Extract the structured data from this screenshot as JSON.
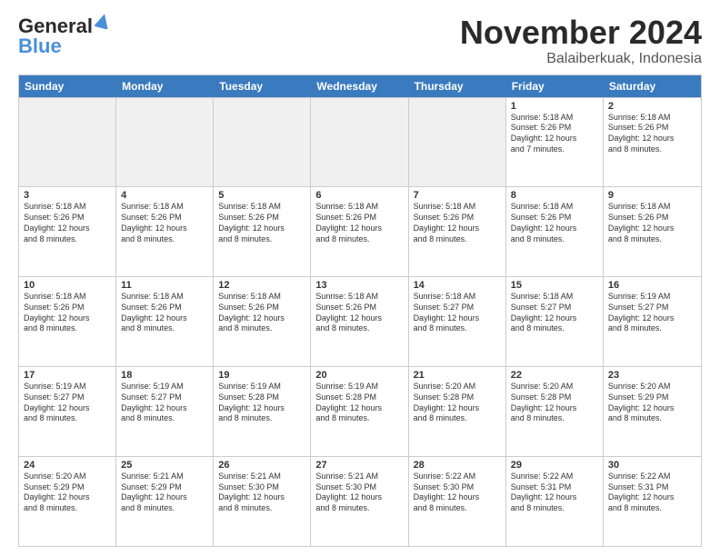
{
  "header": {
    "logo_line1": "General",
    "logo_line2": "Blue",
    "month_title": "November 2024",
    "location": "Balaiberkuak, Indonesia"
  },
  "calendar": {
    "days_of_week": [
      "Sunday",
      "Monday",
      "Tuesday",
      "Wednesday",
      "Thursday",
      "Friday",
      "Saturday"
    ],
    "weeks": [
      [
        {
          "day": "",
          "info": "",
          "empty": true
        },
        {
          "day": "",
          "info": "",
          "empty": true
        },
        {
          "day": "",
          "info": "",
          "empty": true
        },
        {
          "day": "",
          "info": "",
          "empty": true
        },
        {
          "day": "",
          "info": "",
          "empty": true
        },
        {
          "day": "1",
          "info": "Sunrise: 5:18 AM\nSunset: 5:26 PM\nDaylight: 12 hours\nand 7 minutes.",
          "empty": false
        },
        {
          "day": "2",
          "info": "Sunrise: 5:18 AM\nSunset: 5:26 PM\nDaylight: 12 hours\nand 8 minutes.",
          "empty": false
        }
      ],
      [
        {
          "day": "3",
          "info": "Sunrise: 5:18 AM\nSunset: 5:26 PM\nDaylight: 12 hours\nand 8 minutes.",
          "empty": false
        },
        {
          "day": "4",
          "info": "Sunrise: 5:18 AM\nSunset: 5:26 PM\nDaylight: 12 hours\nand 8 minutes.",
          "empty": false
        },
        {
          "day": "5",
          "info": "Sunrise: 5:18 AM\nSunset: 5:26 PM\nDaylight: 12 hours\nand 8 minutes.",
          "empty": false
        },
        {
          "day": "6",
          "info": "Sunrise: 5:18 AM\nSunset: 5:26 PM\nDaylight: 12 hours\nand 8 minutes.",
          "empty": false
        },
        {
          "day": "7",
          "info": "Sunrise: 5:18 AM\nSunset: 5:26 PM\nDaylight: 12 hours\nand 8 minutes.",
          "empty": false
        },
        {
          "day": "8",
          "info": "Sunrise: 5:18 AM\nSunset: 5:26 PM\nDaylight: 12 hours\nand 8 minutes.",
          "empty": false
        },
        {
          "day": "9",
          "info": "Sunrise: 5:18 AM\nSunset: 5:26 PM\nDaylight: 12 hours\nand 8 minutes.",
          "empty": false
        }
      ],
      [
        {
          "day": "10",
          "info": "Sunrise: 5:18 AM\nSunset: 5:26 PM\nDaylight: 12 hours\nand 8 minutes.",
          "empty": false
        },
        {
          "day": "11",
          "info": "Sunrise: 5:18 AM\nSunset: 5:26 PM\nDaylight: 12 hours\nand 8 minutes.",
          "empty": false
        },
        {
          "day": "12",
          "info": "Sunrise: 5:18 AM\nSunset: 5:26 PM\nDaylight: 12 hours\nand 8 minutes.",
          "empty": false
        },
        {
          "day": "13",
          "info": "Sunrise: 5:18 AM\nSunset: 5:26 PM\nDaylight: 12 hours\nand 8 minutes.",
          "empty": false
        },
        {
          "day": "14",
          "info": "Sunrise: 5:18 AM\nSunset: 5:27 PM\nDaylight: 12 hours\nand 8 minutes.",
          "empty": false
        },
        {
          "day": "15",
          "info": "Sunrise: 5:18 AM\nSunset: 5:27 PM\nDaylight: 12 hours\nand 8 minutes.",
          "empty": false
        },
        {
          "day": "16",
          "info": "Sunrise: 5:19 AM\nSunset: 5:27 PM\nDaylight: 12 hours\nand 8 minutes.",
          "empty": false
        }
      ],
      [
        {
          "day": "17",
          "info": "Sunrise: 5:19 AM\nSunset: 5:27 PM\nDaylight: 12 hours\nand 8 minutes.",
          "empty": false
        },
        {
          "day": "18",
          "info": "Sunrise: 5:19 AM\nSunset: 5:27 PM\nDaylight: 12 hours\nand 8 minutes.",
          "empty": false
        },
        {
          "day": "19",
          "info": "Sunrise: 5:19 AM\nSunset: 5:28 PM\nDaylight: 12 hours\nand 8 minutes.",
          "empty": false
        },
        {
          "day": "20",
          "info": "Sunrise: 5:19 AM\nSunset: 5:28 PM\nDaylight: 12 hours\nand 8 minutes.",
          "empty": false
        },
        {
          "day": "21",
          "info": "Sunrise: 5:20 AM\nSunset: 5:28 PM\nDaylight: 12 hours\nand 8 minutes.",
          "empty": false
        },
        {
          "day": "22",
          "info": "Sunrise: 5:20 AM\nSunset: 5:28 PM\nDaylight: 12 hours\nand 8 minutes.",
          "empty": false
        },
        {
          "day": "23",
          "info": "Sunrise: 5:20 AM\nSunset: 5:29 PM\nDaylight: 12 hours\nand 8 minutes.",
          "empty": false
        }
      ],
      [
        {
          "day": "24",
          "info": "Sunrise: 5:20 AM\nSunset: 5:29 PM\nDaylight: 12 hours\nand 8 minutes.",
          "empty": false
        },
        {
          "day": "25",
          "info": "Sunrise: 5:21 AM\nSunset: 5:29 PM\nDaylight: 12 hours\nand 8 minutes.",
          "empty": false
        },
        {
          "day": "26",
          "info": "Sunrise: 5:21 AM\nSunset: 5:30 PM\nDaylight: 12 hours\nand 8 minutes.",
          "empty": false
        },
        {
          "day": "27",
          "info": "Sunrise: 5:21 AM\nSunset: 5:30 PM\nDaylight: 12 hours\nand 8 minutes.",
          "empty": false
        },
        {
          "day": "28",
          "info": "Sunrise: 5:22 AM\nSunset: 5:30 PM\nDaylight: 12 hours\nand 8 minutes.",
          "empty": false
        },
        {
          "day": "29",
          "info": "Sunrise: 5:22 AM\nSunset: 5:31 PM\nDaylight: 12 hours\nand 8 minutes.",
          "empty": false
        },
        {
          "day": "30",
          "info": "Sunrise: 5:22 AM\nSunset: 5:31 PM\nDaylight: 12 hours\nand 8 minutes.",
          "empty": false
        }
      ]
    ]
  }
}
